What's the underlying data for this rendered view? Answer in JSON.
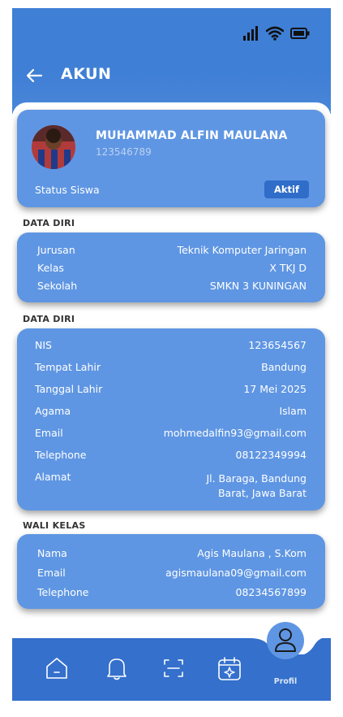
{
  "header": {
    "title": "AKUN"
  },
  "profile": {
    "name": "MUHAMMAD ALFIN MAULANA",
    "id": "123546789",
    "status_label": "Status Siswa",
    "status_badge": "Aktif"
  },
  "sections": {
    "data_diri_1": {
      "label": "DATA DIRI",
      "rows": [
        {
          "key": "Jurusan",
          "value": "Teknik Komputer Jaringan"
        },
        {
          "key": "Kelas",
          "value": "X TKJ D"
        },
        {
          "key": "Sekolah",
          "value": "SMKN 3 KUNINGAN"
        }
      ]
    },
    "data_diri_2": {
      "label": "DATA DIRI",
      "rows": [
        {
          "key": "NIS",
          "value": "123654567"
        },
        {
          "key": "Tempat Lahir",
          "value": "Bandung"
        },
        {
          "key": "Tanggal Lahir",
          "value": "17 Mei 2025"
        },
        {
          "key": "Agama",
          "value": "Islam"
        },
        {
          "key": "Email",
          "value": "mohmedalfin93@gmail.com"
        },
        {
          "key": "Telephone",
          "value": "08122349994"
        },
        {
          "key": "Alamat",
          "value": "Jl. Baraga, Bandung",
          "value2": "Barat, Jawa Barat"
        }
      ]
    },
    "wali_kelas": {
      "label": "WALI KELAS",
      "rows": [
        {
          "key": "Nama",
          "value": "Agis Maulana , S.Kom"
        },
        {
          "key": "Email",
          "value": "agismaulana09@gmail.com"
        },
        {
          "key": "Telephone",
          "value": "08234567899"
        }
      ]
    }
  },
  "nav": {
    "items": [
      "home-icon",
      "bell-icon",
      "scan-icon",
      "calendar-icon",
      "profile-icon"
    ],
    "active_label": "Profil"
  },
  "colors": {
    "header": "#3f7fd6",
    "card": "#5f96e3",
    "navbar": "#3470cc",
    "badge": "#2f6dc9"
  }
}
